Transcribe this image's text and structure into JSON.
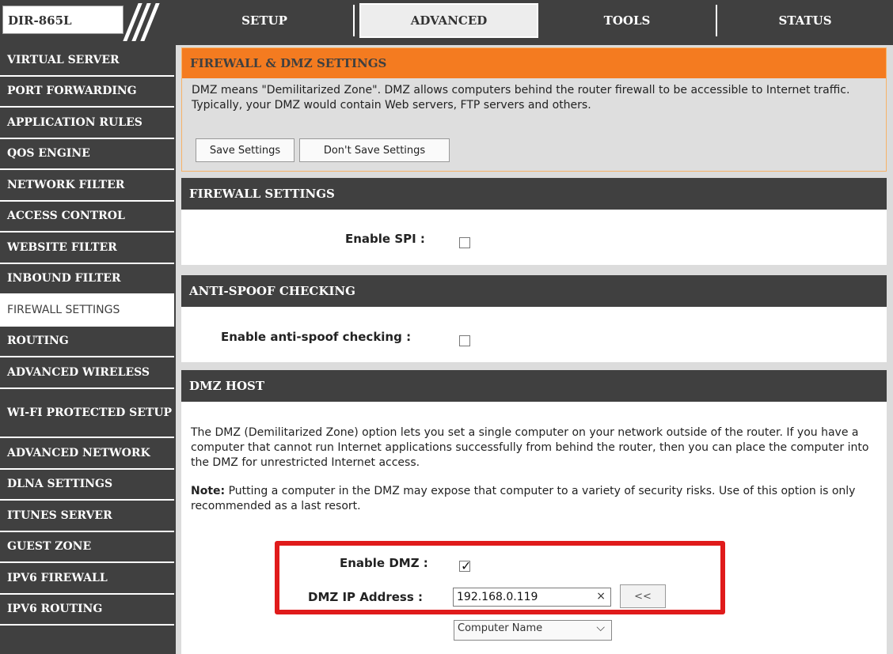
{
  "model": {
    "name": "DIR-865L"
  },
  "tabs": [
    "SETUP",
    "ADVANCED",
    "TOOLS",
    "STATUS"
  ],
  "active_tab": "ADVANCED",
  "sidebar": {
    "items": [
      {
        "label": "VIRTUAL SERVER"
      },
      {
        "label": "PORT FORWARDING"
      },
      {
        "label": "APPLICATION RULES"
      },
      {
        "label": "QOS ENGINE"
      },
      {
        "label": "NETWORK FILTER"
      },
      {
        "label": "ACCESS CONTROL"
      },
      {
        "label": "WEBSITE FILTER"
      },
      {
        "label": "INBOUND FILTER"
      },
      {
        "label": "FIREWALL SETTINGS"
      },
      {
        "label": "ROUTING"
      },
      {
        "label": "ADVANCED WIRELESS"
      },
      {
        "label": "WI-FI PROTECTED SETUP"
      },
      {
        "label": "ADVANCED NETWORK"
      },
      {
        "label": "DLNA SETTINGS"
      },
      {
        "label": "ITUNES SERVER"
      },
      {
        "label": "GUEST ZONE"
      },
      {
        "label": "IPV6 FIREWALL"
      },
      {
        "label": "IPV6 ROUTING"
      }
    ],
    "active": "FIREWALL SETTINGS"
  },
  "fw_dmz": {
    "title": "FIREWALL & DMZ SETTINGS",
    "description": "DMZ means \"Demilitarized Zone\". DMZ allows computers behind the router firewall to be accessible to Internet traffic. Typically, your DMZ would contain Web servers, FTP servers and others.",
    "save_label": "Save Settings",
    "dont_save_label": "Don't Save Settings"
  },
  "firewall": {
    "title": "FIREWALL SETTINGS",
    "spi_label": "Enable SPI :",
    "spi_checked": false
  },
  "anti_spoof": {
    "title": "ANTI-SPOOF CHECKING",
    "label": "Enable anti-spoof checking :",
    "checked": false
  },
  "dmz_host": {
    "title": "DMZ HOST",
    "description": "The DMZ (Demilitarized Zone) option lets you set a single computer on your network outside of the router. If you have a computer that cannot run Internet applications successfully from behind the router, then you can place the computer into the DMZ for unrestricted Internet access.",
    "note_label": "Note:",
    "note_text": " Putting a computer in the DMZ may expose that computer to a variety of security risks. Use of this option is only recommended as a last resort.",
    "enable_label": "Enable DMZ :",
    "enable_checked": true,
    "ip_label": "DMZ IP Address :",
    "ip_value": "192.168.0.119",
    "clear_symbol": "×",
    "select_button": "<<",
    "computer_select": "Computer Name",
    "highlight_color": "#e01b1b"
  }
}
